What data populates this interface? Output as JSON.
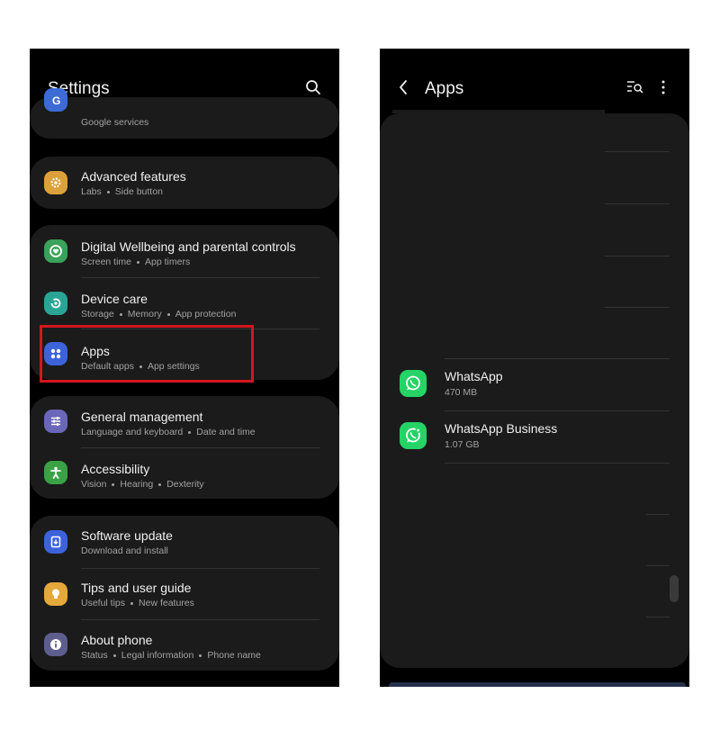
{
  "left": {
    "header": {
      "title": "Settings",
      "search_icon": "search-icon"
    },
    "items": [
      {
        "key": "google",
        "title": "Google",
        "subtitle": [
          "Google services"
        ],
        "icon": "google-icon",
        "color": "#3d6bd6"
      },
      {
        "key": "advanced",
        "title": "Advanced features",
        "subtitle": [
          "Labs",
          "Side button"
        ],
        "icon": "gear-star-icon",
        "color": "#dca13a"
      },
      {
        "key": "wellbeing",
        "title": "Digital Wellbeing and parental controls",
        "subtitle": [
          "Screen time",
          "App timers"
        ],
        "icon": "heart-circle-icon",
        "color": "#3aa25a"
      },
      {
        "key": "devicecare",
        "title": "Device care",
        "subtitle": [
          "Storage",
          "Memory",
          "App protection"
        ],
        "icon": "refresh-circle-icon",
        "color": "#2aa595"
      },
      {
        "key": "apps",
        "title": "Apps",
        "subtitle": [
          "Default apps",
          "App settings"
        ],
        "icon": "apps-grid-icon",
        "color": "#3c63d9"
      },
      {
        "key": "general",
        "title": "General management",
        "subtitle": [
          "Language and keyboard",
          "Date and time"
        ],
        "icon": "sliders-icon",
        "color": "#6b67b8"
      },
      {
        "key": "accessibility",
        "title": "Accessibility",
        "subtitle": [
          "Vision",
          "Hearing",
          "Dexterity"
        ],
        "icon": "person-icon",
        "color": "#3aa245"
      },
      {
        "key": "software",
        "title": "Software update",
        "subtitle": [
          "Download and install"
        ],
        "icon": "update-icon",
        "color": "#3c63d9"
      },
      {
        "key": "tips",
        "title": "Tips and user guide",
        "subtitle": [
          "Useful tips",
          "New features"
        ],
        "icon": "lightbulb-icon",
        "color": "#e5a83a"
      },
      {
        "key": "about",
        "title": "About phone",
        "subtitle": [
          "Status",
          "Legal information",
          "Phone name"
        ],
        "icon": "info-icon",
        "color": "#5e5e8e"
      }
    ],
    "highlight_color": "#d3161c"
  },
  "right": {
    "header": {
      "title": "Apps",
      "back_icon": "back-chevron-icon",
      "filter_icon": "filter-search-icon",
      "more_icon": "more-vert-icon"
    },
    "apps": [
      {
        "name": "WhatsApp",
        "size": "470 MB",
        "icon": "whatsapp-icon"
      },
      {
        "name": "WhatsApp Business",
        "size": "1.07 GB",
        "icon": "whatsapp-business-icon"
      }
    ]
  }
}
